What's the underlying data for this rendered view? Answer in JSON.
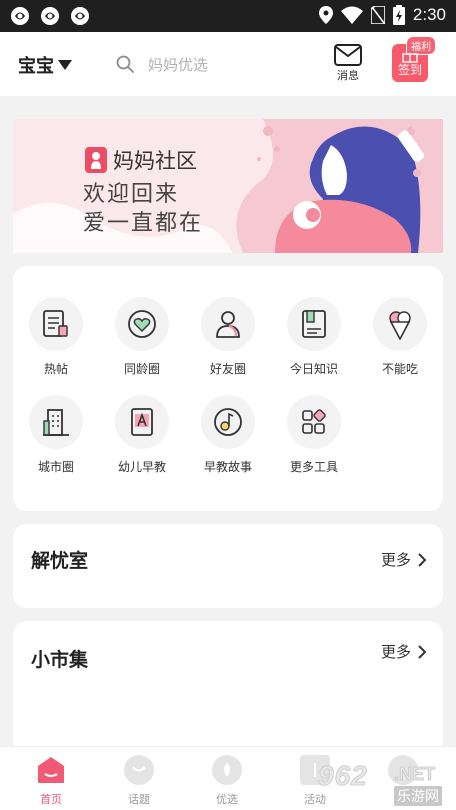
{
  "status_bar": {
    "time": "2:30"
  },
  "header": {
    "baby_label": "宝宝",
    "search_placeholder": "妈妈优选",
    "message_label": "消息",
    "signin_label": "签到",
    "signin_badge": "福利"
  },
  "banner": {
    "brand": "妈妈社区",
    "line1": "欢迎回来",
    "line2": "爱一直都在"
  },
  "tools": [
    {
      "label": "热帖",
      "icon": "hot-post-icon"
    },
    {
      "label": "同龄圈",
      "icon": "heart-icon"
    },
    {
      "label": "好友圈",
      "icon": "friends-icon"
    },
    {
      "label": "今日知识",
      "icon": "book-icon"
    },
    {
      "label": "不能吃",
      "icon": "ice-cream-icon"
    },
    {
      "label": "城市圈",
      "icon": "building-icon"
    },
    {
      "label": "幼儿早教",
      "icon": "alphabet-book-icon"
    },
    {
      "label": "早教故事",
      "icon": "music-note-icon"
    },
    {
      "label": "更多工具",
      "icon": "grid-icon"
    }
  ],
  "sections": [
    {
      "title": "解忧室",
      "more": "更多"
    },
    {
      "title": "小市集",
      "more": "更多"
    }
  ],
  "tabbar": [
    {
      "label": "首页",
      "active": true
    },
    {
      "label": "话题",
      "active": false
    },
    {
      "label": "优选",
      "active": false
    },
    {
      "label": "活动",
      "active": false
    }
  ],
  "watermark": {
    "number": "962",
    "domain": ".NET",
    "cn": "乐游网"
  },
  "colors": {
    "accent": "#f05a75",
    "signin": "#f75a6b",
    "banner_bg": "#fbe8ec",
    "mom_hair": "#4a4fb0"
  }
}
